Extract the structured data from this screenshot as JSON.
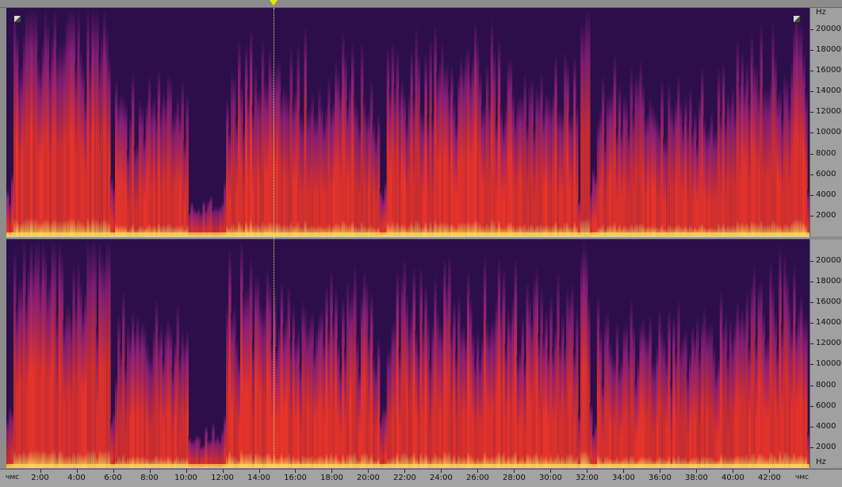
{
  "view": "spectral-frequency-display",
  "frequency_axis": {
    "unit_label": "Hz",
    "ticks": [
      "20000",
      "18000",
      "16000",
      "14000",
      "12000",
      "10000",
      "8000",
      "6000",
      "4000",
      "2000"
    ],
    "tick_values": [
      20000,
      18000,
      16000,
      14000,
      12000,
      10000,
      8000,
      6000,
      4000,
      2000
    ],
    "max_hz": 22050
  },
  "time_axis": {
    "unit_label_left": "чмс",
    "unit_label_right": "чмс",
    "ticks": [
      "2:00",
      "4:00",
      "6:00",
      "8:00",
      "10:00",
      "12:00",
      "14:00",
      "16:00",
      "18:00",
      "20:00",
      "22:00",
      "24:00",
      "26:00",
      "28:00",
      "30:00",
      "32:00",
      "34:00",
      "36:00",
      "38:00",
      "40:00",
      "42:00"
    ],
    "tick_minutes": [
      2,
      4,
      6,
      8,
      10,
      12,
      14,
      16,
      18,
      20,
      22,
      24,
      26,
      28,
      30,
      32,
      34,
      36,
      38,
      40,
      42
    ],
    "start_minutes": 0.15,
    "end_minutes": 44.2
  },
  "playhead_minutes": 14.8,
  "channels": [
    {
      "id": "left",
      "name": "channel-1"
    },
    {
      "id": "right",
      "name": "channel-2"
    }
  ],
  "colors": {
    "low": "#2b0e4a",
    "mid": "#8a1f7a",
    "high": "#e8342a",
    "peak": "#ffd95a",
    "playhead": "#e6e600"
  }
}
